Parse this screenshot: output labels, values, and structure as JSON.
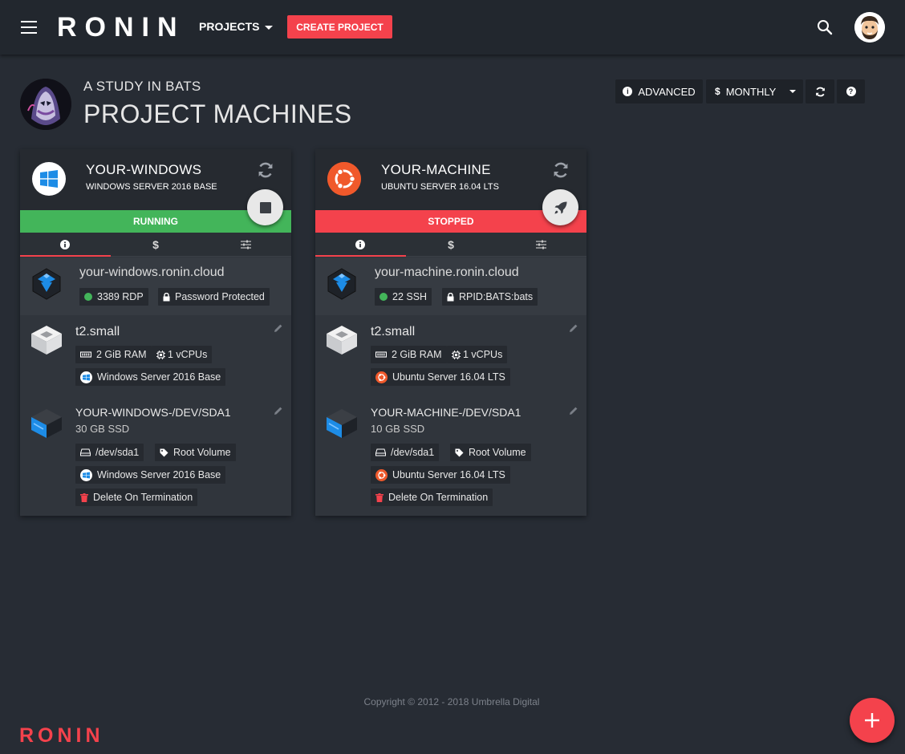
{
  "app": {
    "brand": "RONIN",
    "footer_brand": "RONIN",
    "accent": "#f4424c"
  },
  "topbar": {
    "projects_label": "PROJECTS",
    "create_label": "CREATE PROJECT"
  },
  "header": {
    "project_name": "A STUDY IN BATS",
    "title": "PROJECT MACHINES"
  },
  "toolbar": {
    "advanced_label": "ADVANCED",
    "billing_label": "MONTHLY"
  },
  "machines": [
    {
      "name": "YOUR-WINDOWS",
      "os": "WINDOWS SERVER 2016 BASE",
      "status": "RUNNING",
      "status_color": "#43b55a",
      "dns": "your-windows.ronin.cloud",
      "port": "3389 RDP",
      "access": "Password Protected",
      "instance_type": "t2.small",
      "ram": "2 GiB RAM",
      "cpu": "1 vCPUs",
      "image": "Windows Server 2016 Base",
      "volume_name": "YOUR-WINDOWS-/DEV/SDA1",
      "volume_size": "30 GB SSD",
      "device": "/dev/sda1",
      "volume_role": "Root Volume",
      "volume_image": "Windows Server 2016 Base",
      "termination": "Delete On Termination"
    },
    {
      "name": "YOUR-MACHINE",
      "os": "UBUNTU SERVER 16.04 LTS",
      "status": "STOPPED",
      "status_color": "#f4424c",
      "dns": "your-machine.ronin.cloud",
      "port": "22 SSH",
      "access": "RPID:BATS:bats",
      "instance_type": "t2.small",
      "ram": "2 GiB RAM",
      "cpu": "1 vCPUs",
      "image": "Ubuntu Server 16.04 LTS",
      "volume_name": "YOUR-MACHINE-/DEV/SDA1",
      "volume_size": "10 GB SSD",
      "device": "/dev/sda1",
      "volume_role": "Root Volume",
      "volume_image": "Ubuntu Server 16.04 LTS",
      "termination": "Delete On Termination"
    }
  ],
  "footer": {
    "copyright": "Copyright © 2012 - 2018 Umbrella Digital"
  }
}
